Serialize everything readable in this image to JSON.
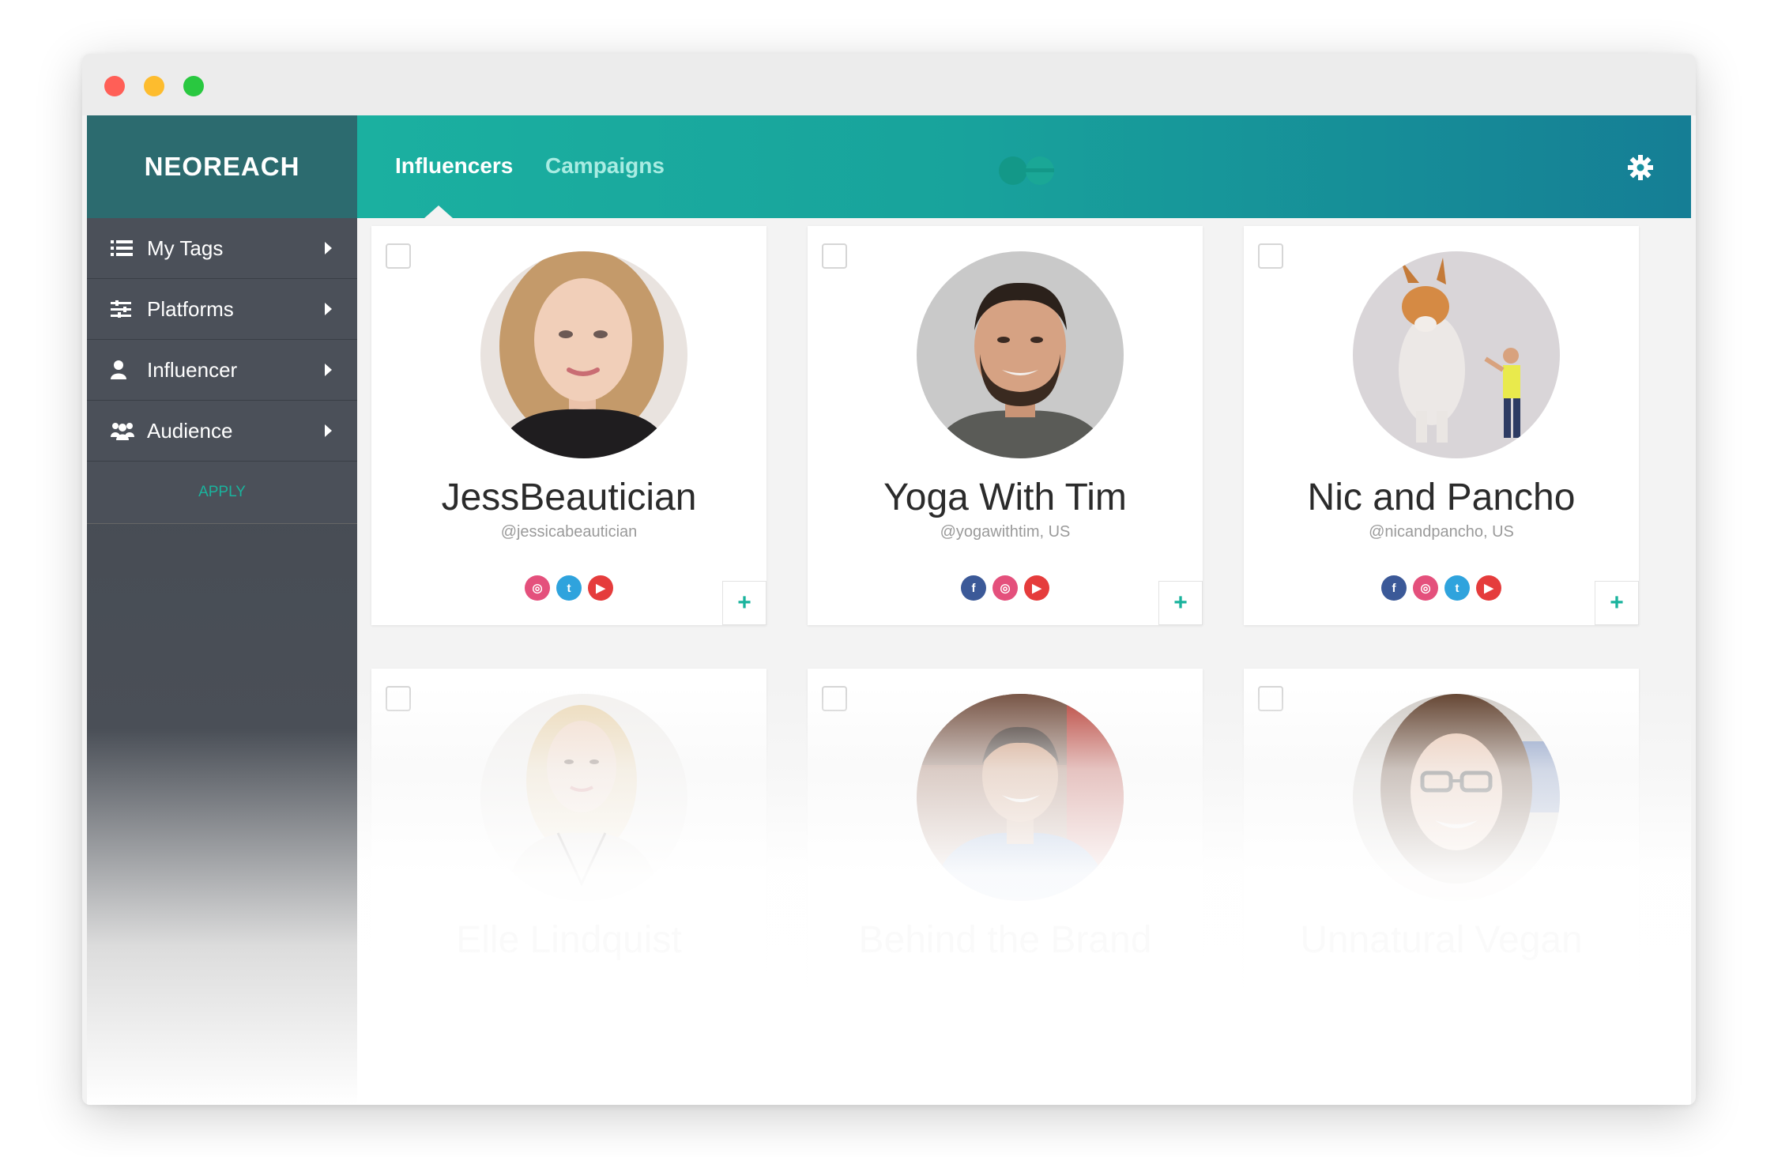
{
  "app": {
    "logo": "NEOREACH"
  },
  "nav": {
    "tabs": [
      "Influencers",
      "Campaigns"
    ]
  },
  "sidebar": {
    "items": [
      {
        "label": "My Tags",
        "icon": "list-icon"
      },
      {
        "label": "Platforms",
        "icon": "sliders-icon"
      },
      {
        "label": "Influencer",
        "icon": "person-icon"
      },
      {
        "label": "Audience",
        "icon": "group-icon"
      }
    ],
    "apply": "APPLY"
  },
  "influencers": [
    {
      "name": "JessBeautician",
      "handle": "@jessicabeautician",
      "socials": [
        "instagram",
        "twitter",
        "youtube"
      ]
    },
    {
      "name": "Yoga With Tim",
      "handle": "@yogawithtim, US",
      "socials": [
        "facebook",
        "instagram",
        "youtube"
      ]
    },
    {
      "name": "Nic and Pancho",
      "handle": "@nicandpancho, US",
      "socials": [
        "facebook",
        "instagram",
        "twitter",
        "youtube"
      ]
    },
    {
      "name": "Elle Lindquist",
      "handle": "",
      "socials": []
    },
    {
      "name": "Behind the Brand",
      "handle": "",
      "socials": []
    },
    {
      "name": "Unnatural Vegan",
      "handle": "",
      "socials": []
    }
  ],
  "colors": {
    "accent": "#1ab39d",
    "sidebar": "#4b5059",
    "logo_bg": "#2c6b6f",
    "header_start": "#1bb0a0",
    "header_end": "#157e95"
  }
}
